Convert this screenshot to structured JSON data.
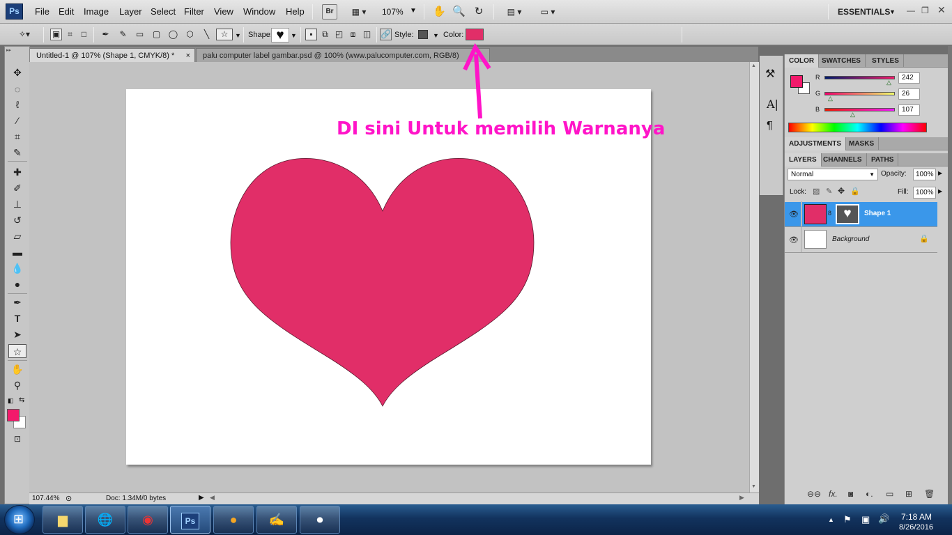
{
  "app": {
    "logo": "Ps"
  },
  "menubar": {
    "items": [
      "File",
      "Edit",
      "Image",
      "Layer",
      "Select",
      "Filter",
      "View",
      "Window",
      "Help"
    ],
    "bridge_label": "Br",
    "zoom": "107%",
    "workspace": "ESSENTIALS"
  },
  "options": {
    "shape_label": "Shape:",
    "style_label": "Style:",
    "color_label": "Color:",
    "color_value": "#e12e68"
  },
  "tabs": [
    {
      "label": "Untitled-1 @ 107% (Shape 1, CMYK/8) *",
      "close": "×"
    },
    {
      "label": "palu computer label gambar.psd @ 100% (www.palucomputer.com, RGB/8)"
    }
  ],
  "annotation": {
    "text": "DI sini Untuk memilih Warnanya",
    "color": "#ff14c8"
  },
  "status": {
    "zoom": "107.44%",
    "doc": "Doc: 1.34M/0 bytes"
  },
  "color_panel": {
    "tabs": [
      "COLOR",
      "SWATCHES",
      "STYLES"
    ],
    "r_label": "R",
    "g_label": "G",
    "b_label": "B",
    "r": "242",
    "g": "26",
    "b": "107",
    "fg": "#f21a6b"
  },
  "adjust_panel": {
    "tabs": [
      "ADJUSTMENTS",
      "MASKS"
    ]
  },
  "layers_panel": {
    "tabs": [
      "LAYERS",
      "CHANNELS",
      "PATHS"
    ],
    "blend_mode": "Normal",
    "opacity_label": "Opacity:",
    "opacity": "100%",
    "lock_label": "Lock:",
    "fill_label": "Fill:",
    "fill": "100%",
    "layers": [
      {
        "name": "Shape 1",
        "selected": true
      },
      {
        "name": "Background",
        "selected": false
      }
    ]
  },
  "shape": {
    "fill": "#e12e68"
  },
  "taskbar": {
    "time": "7:18 AM",
    "date": "8/26/2016"
  }
}
